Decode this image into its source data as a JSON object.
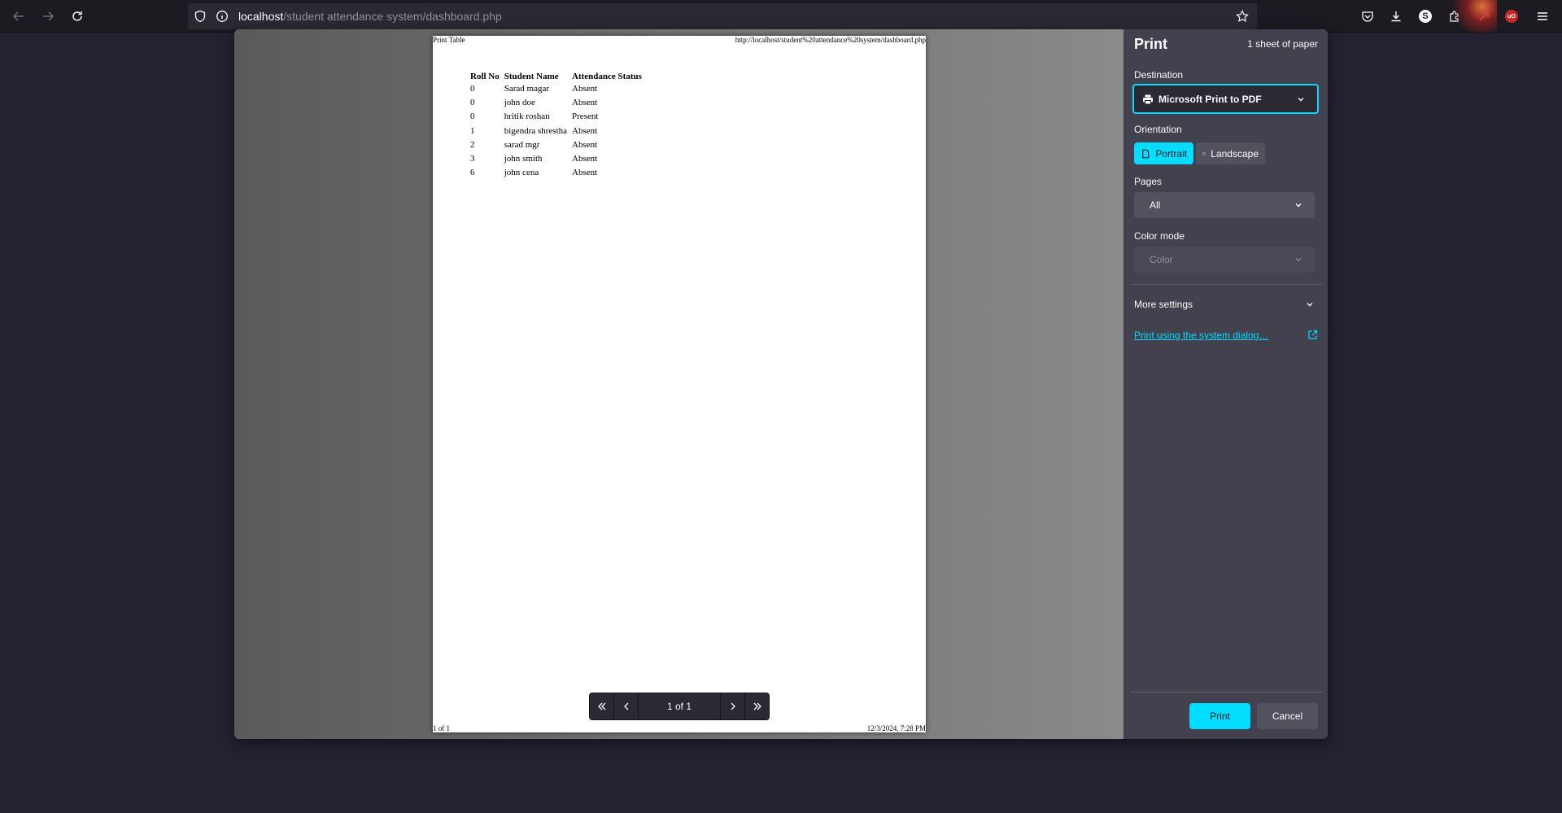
{
  "browser": {
    "url_host": "localhost",
    "url_path": "/student attendance system/dashboard.php"
  },
  "print_preview": {
    "header_left": "Print Table",
    "header_right": "http://localhost/student%20attendance%20system/dashboard.php",
    "footer_left": "1 of 1",
    "footer_right": "12/3/2024, 7:28 PM",
    "table": {
      "headers": [
        "Roll No",
        "Student Name",
        "Attendance Status"
      ],
      "rows": [
        [
          "0",
          "Sarad magar",
          "Absent"
        ],
        [
          "0",
          "john doe",
          "Absent"
        ],
        [
          "0",
          "hritik roshan",
          "Present"
        ],
        [
          "1",
          "bigendra shrestha",
          "Absent"
        ],
        [
          "2",
          "sarad mgr",
          "Absent"
        ],
        [
          "3",
          "john smith",
          "Absent"
        ],
        [
          "6",
          "john cena",
          "Absent"
        ]
      ]
    },
    "pager_label": "1 of 1"
  },
  "print_panel": {
    "title": "Print",
    "sheet_count": "1 sheet of paper",
    "destination_label": "Destination",
    "destination_value": "Microsoft Print to PDF",
    "orientation_label": "Orientation",
    "portrait_label": "Portrait",
    "landscape_label": "Landscape",
    "pages_label": "Pages",
    "pages_value": "All",
    "color_mode_label": "Color mode",
    "color_mode_value": "Color",
    "more_settings": "More settings",
    "system_dialog_link": "Print using the system dialog…",
    "print_button": "Print",
    "cancel_button": "Cancel"
  },
  "colors": {
    "accent": "#00ddff",
    "panel_bg": "#42414d",
    "toolbar_bg": "#1c1b22",
    "page_bg": "#232230"
  }
}
